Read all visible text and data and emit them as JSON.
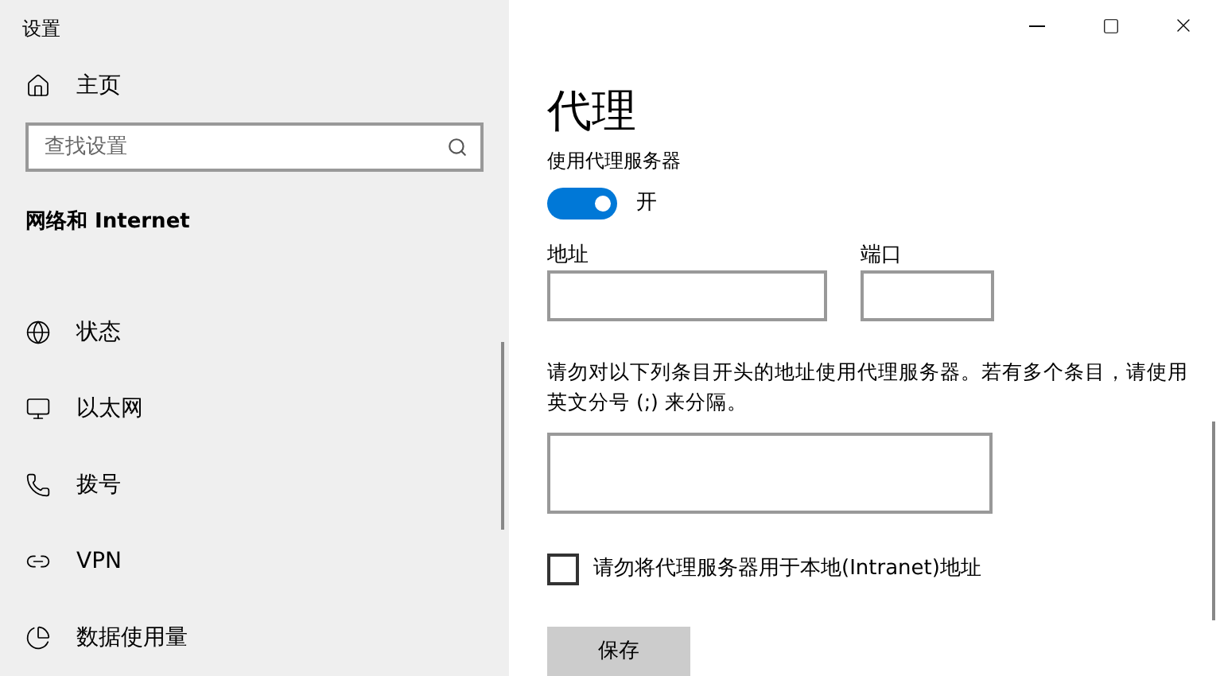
{
  "window": {
    "title": "设置"
  },
  "sidebar": {
    "home": "主页",
    "search": {
      "placeholder": "查找设置"
    },
    "section": "网络和 Internet",
    "items": [
      {
        "label": "状态"
      },
      {
        "label": "以太网"
      },
      {
        "label": "拨号"
      },
      {
        "label": "VPN"
      },
      {
        "label": "数据使用量"
      }
    ]
  },
  "page": {
    "title": "代理",
    "proxy_toggle": {
      "label": "使用代理服务器",
      "on": true,
      "state_text": "开"
    },
    "address": {
      "label": "地址"
    },
    "port": {
      "label": "端口"
    },
    "exceptions": {
      "description": "请勿对以下列条目开头的地址使用代理服务器。若有多个条目，请使用英文分号 (;) 来分隔。"
    },
    "local_checkbox": {
      "label": "请勿将代理服务器用于本地(Intranet)地址",
      "checked": false
    },
    "save_button": "保存"
  }
}
